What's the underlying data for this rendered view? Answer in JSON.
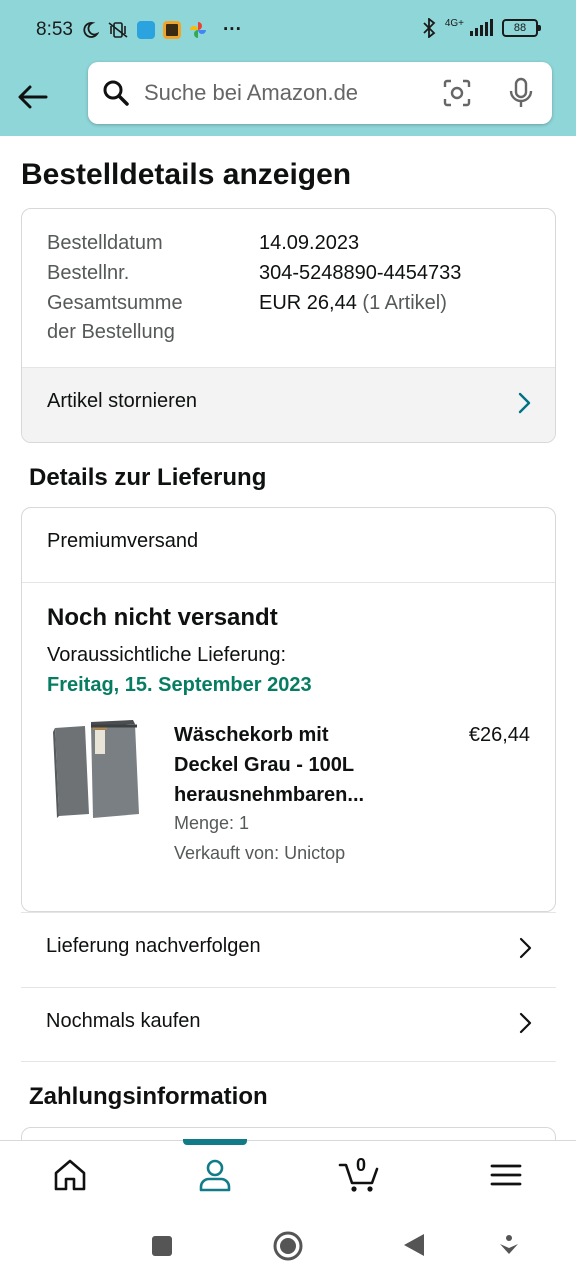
{
  "status_bar": {
    "time": "8:53",
    "overflow": "···",
    "network": "4G+",
    "battery": "88"
  },
  "search": {
    "placeholder": "Suche bei Amazon.de"
  },
  "page": {
    "title": "Bestelldetails anzeigen"
  },
  "order": {
    "date_label": "Bestelldatum",
    "date_value": "14.09.2023",
    "number_label": "Bestellnr.",
    "number_value": "304-5248890-4454733",
    "total_label_line1": "Gesamtsumme",
    "total_label_line2": "der Bestellung",
    "total_value": "EUR 26,44",
    "total_items": "(1 Artikel)",
    "cancel_label": "Artikel stornieren"
  },
  "delivery": {
    "section_title": "Details zur Lieferung",
    "shipping_type": "Premiumversand",
    "status": "Noch nicht versandt",
    "eta_label": "Voraussichtliche Lieferung:",
    "eta_date": "Freitag, 15. September 2023",
    "product": {
      "title_line1": "Wäschekorb mit",
      "title_line2": "Deckel Grau - 100L",
      "title_line3": "herausnehmbaren...",
      "price": "€26,44",
      "quantity": "Menge: 1",
      "seller": "Verkauft von: Unictop"
    }
  },
  "actions": {
    "track": "Lieferung nachverfolgen",
    "buy_again": "Nochmals kaufen"
  },
  "payment": {
    "section_title": "Zahlungsinformation"
  },
  "bottom_nav": {
    "cart_count": "0",
    "active": "account"
  },
  "colors": {
    "header_bg": "#8fd6d8",
    "eta_green": "#067d62",
    "active_teal": "#127b88",
    "chevron_teal": "#007185"
  }
}
